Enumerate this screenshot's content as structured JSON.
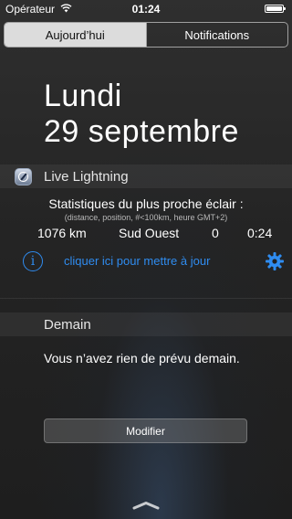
{
  "status_bar": {
    "carrier": "Opérateur",
    "time": "01:24",
    "wifi_icon": "wifi-icon",
    "battery_icon": "battery-icon"
  },
  "tabs": [
    {
      "label": "Aujourd’hui",
      "active": true
    },
    {
      "label": "Notifications",
      "active": false
    }
  ],
  "today": {
    "day": "Lundi",
    "date": "29 septembre"
  },
  "widget": {
    "app_icon": "compass-icon",
    "app_name": "Live Lightning",
    "stats_title": "Statistiques du plus proche éclair :",
    "stats_subtitle": "(distance, position, #<100km, heure GMT+2)",
    "values": {
      "distance": "1076 km",
      "position": "Sud Ouest",
      "count": "0",
      "hour": "0:24"
    },
    "info_icon": "info-icon",
    "update_link": "cliquer ici pour mettre à jour",
    "settings_icon": "gear-icon",
    "accent_color": "#2f8cf0"
  },
  "tomorrow": {
    "title": "Demain",
    "message": "Vous n’avez rien de prévu demain."
  },
  "modify_button": "Modifier",
  "grabber_icon": "chevron-up-icon"
}
